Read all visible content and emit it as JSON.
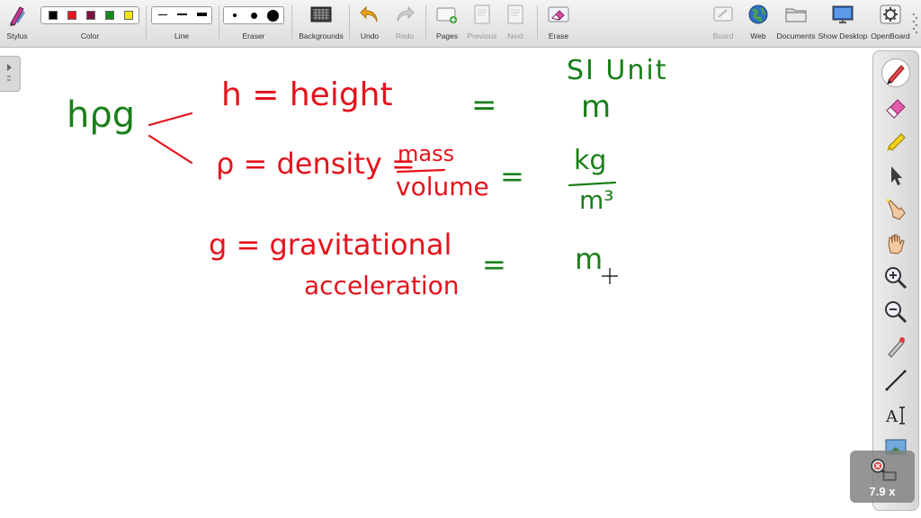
{
  "toolbar": {
    "stylus_label": "Stylus",
    "color_label": "Color",
    "line_label": "Line",
    "eraser_label": "Eraser",
    "backgrounds_label": "Backgrounds",
    "undo_label": "Undo",
    "redo_label": "Redo",
    "pages_label": "Pages",
    "previous_label": "Previous",
    "next_label": "Next",
    "erase_label": "Erase",
    "board_label": "Board",
    "web_label": "Web",
    "documents_label": "Documents",
    "show_desktop_label": "Show Desktop",
    "openboard_label": "OpenBoard",
    "colors": [
      "#000000",
      "#e8151b",
      "#7a1640",
      "#148a1e",
      "#f5e60a"
    ]
  },
  "board": {
    "notes": {
      "heading": "hρg",
      "si_header": "SI Unit",
      "h_def": "h = height",
      "h_eq": "=",
      "h_unit": "m",
      "rho_def": "ρ = density =",
      "rho_num": "mass",
      "rho_den": "volume",
      "rho_eq": "=",
      "rho_unit_num": "kg",
      "rho_unit_den": "m³",
      "g_def": "g = gravitational",
      "g_def2": "acceleration",
      "g_eq": "=",
      "g_unit": "m"
    },
    "ink_colors": {
      "red": "#e5121b",
      "green": "#1a7f1a"
    }
  },
  "zoom": {
    "label": "7.9 x"
  }
}
